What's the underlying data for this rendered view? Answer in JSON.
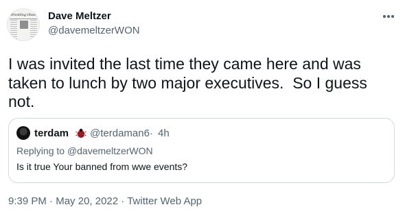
{
  "author": {
    "name": "Dave Meltzer",
    "handle": "@davemeltzerWON",
    "avatar_text": "Wrestling Observer News..."
  },
  "tweet": {
    "text": "I was invited the last time they came here and was taken to lunch by two major executives.  So I guess not."
  },
  "quoted_tweet": {
    "name": "terdam",
    "name_emoji_icon": "ladybug-icon",
    "handle": "@terdaman6",
    "separator": "·",
    "time": "4h",
    "replying_prefix": "Replying to ",
    "replying_to": "@davemeltzerWON",
    "text": "Is it true Your banned from wwe events?"
  },
  "meta": {
    "time": "9:39 PM",
    "sep1": " · ",
    "date": "May 20, 2022",
    "sep2": " · ",
    "source": "Twitter Web App"
  },
  "colors": {
    "primary_text": "#0f1419",
    "secondary_text": "#536471",
    "border": "#cfd9de",
    "ladybug": "#d8232a"
  }
}
